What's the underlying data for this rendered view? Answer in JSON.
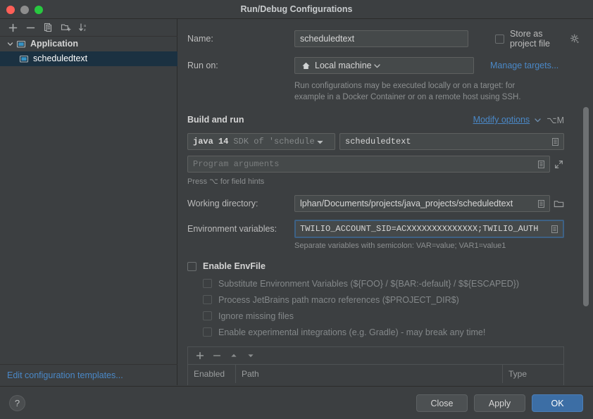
{
  "window": {
    "title": "Run/Debug Configurations",
    "traffic_lights": [
      "close-button",
      "minimize-button",
      "zoom-button"
    ]
  },
  "sidebar": {
    "toolbar": [
      {
        "name": "add-configuration-button",
        "icon": "plus-icon",
        "label": "+"
      },
      {
        "name": "remove-configuration-button",
        "icon": "minus-icon",
        "label": "−"
      },
      {
        "name": "copy-configuration-button",
        "icon": "copy-icon",
        "label": "Copy"
      },
      {
        "name": "save-configuration-button",
        "icon": "folder-add-icon",
        "label": "Save configuration"
      },
      {
        "name": "sort-configurations-button",
        "icon": "sort-az-icon",
        "label": "Sort"
      }
    ],
    "tree": [
      {
        "label": "Application",
        "type": "group",
        "expanded": true,
        "icon": "application-icon"
      },
      {
        "label": "scheduledtext",
        "type": "item",
        "selected": true,
        "icon": "application-icon"
      }
    ],
    "footer_link": "Edit configuration templates..."
  },
  "form": {
    "name_label": "Name:",
    "name_value": "scheduledtext",
    "name_placeholder": "Name",
    "store_as_project_file_label": "Store as project file",
    "store_as_project_file_checked": false,
    "run_on_label": "Run on:",
    "run_on_value": "Local machine",
    "run_on_icon": "home-icon",
    "manage_targets_link": "Manage targets...",
    "run_on_description_line1": "Run configurations may be executed locally or on a target: for",
    "run_on_description_line2": "example in a Docker Container or on a remote host using SSH.",
    "build_and_run_title": "Build and run",
    "modify_options_link": "Modify options",
    "modify_options_shortcut": "⌥M",
    "sdk_value": "java 14",
    "sdk_hint": "SDK of 'schedule",
    "main_class_value": "scheduledtext",
    "program_arguments_placeholder": "Program arguments",
    "field_hints_text": "Press ⌥ for field hints",
    "working_directory_label": "Working directory:",
    "working_directory_value": "lphan/Documents/projects/java_projects/scheduledtext",
    "environment_variables_label": "Environment variables:",
    "environment_variables_value": "TWILIO_ACCOUNT_SID=ACXXXXXXXXXXXXXX;TWILIO_AUTH",
    "environment_variables_hint": "Separate variables with semicolon: VAR=value; VAR1=value1",
    "enable_envfile_label": "Enable EnvFile",
    "enable_envfile_checked": false,
    "envfile_options": [
      {
        "label": "Substitute Environment Variables (${FOO} / ${BAR:-default} / $${ESCAPED})",
        "checked": false,
        "enabled": false
      },
      {
        "label": "Process JetBrains path macro references ($PROJECT_DIR$)",
        "checked": false,
        "enabled": false
      },
      {
        "label": "Ignore missing files",
        "checked": false,
        "enabled": false
      },
      {
        "label": "Enable experimental integrations (e.g. Gradle) - may break any time!",
        "checked": false,
        "enabled": false
      }
    ],
    "envfile_table": {
      "toolbar": [
        {
          "name": "add-envfile-button",
          "icon": "plus-icon"
        },
        {
          "name": "remove-envfile-button",
          "icon": "minus-icon"
        },
        {
          "name": "move-up-button",
          "icon": "arrow-up-icon"
        },
        {
          "name": "move-down-button",
          "icon": "arrow-down-icon"
        }
      ],
      "columns": [
        "Enabled",
        "Path",
        "Type"
      ],
      "rows": []
    }
  },
  "footer": {
    "help_label": "?",
    "buttons": [
      {
        "label": "Close",
        "name": "close-button",
        "primary": false
      },
      {
        "label": "Apply",
        "name": "apply-button",
        "primary": false
      },
      {
        "label": "OK",
        "name": "ok-button",
        "primary": true
      }
    ]
  },
  "colors": {
    "background": "#3c3f41",
    "field_background": "#45494a",
    "accent_link": "#4a88c7",
    "selection": "#1b3141",
    "primary_button": "#3c6ea5",
    "focus_border": "#3d6185"
  }
}
